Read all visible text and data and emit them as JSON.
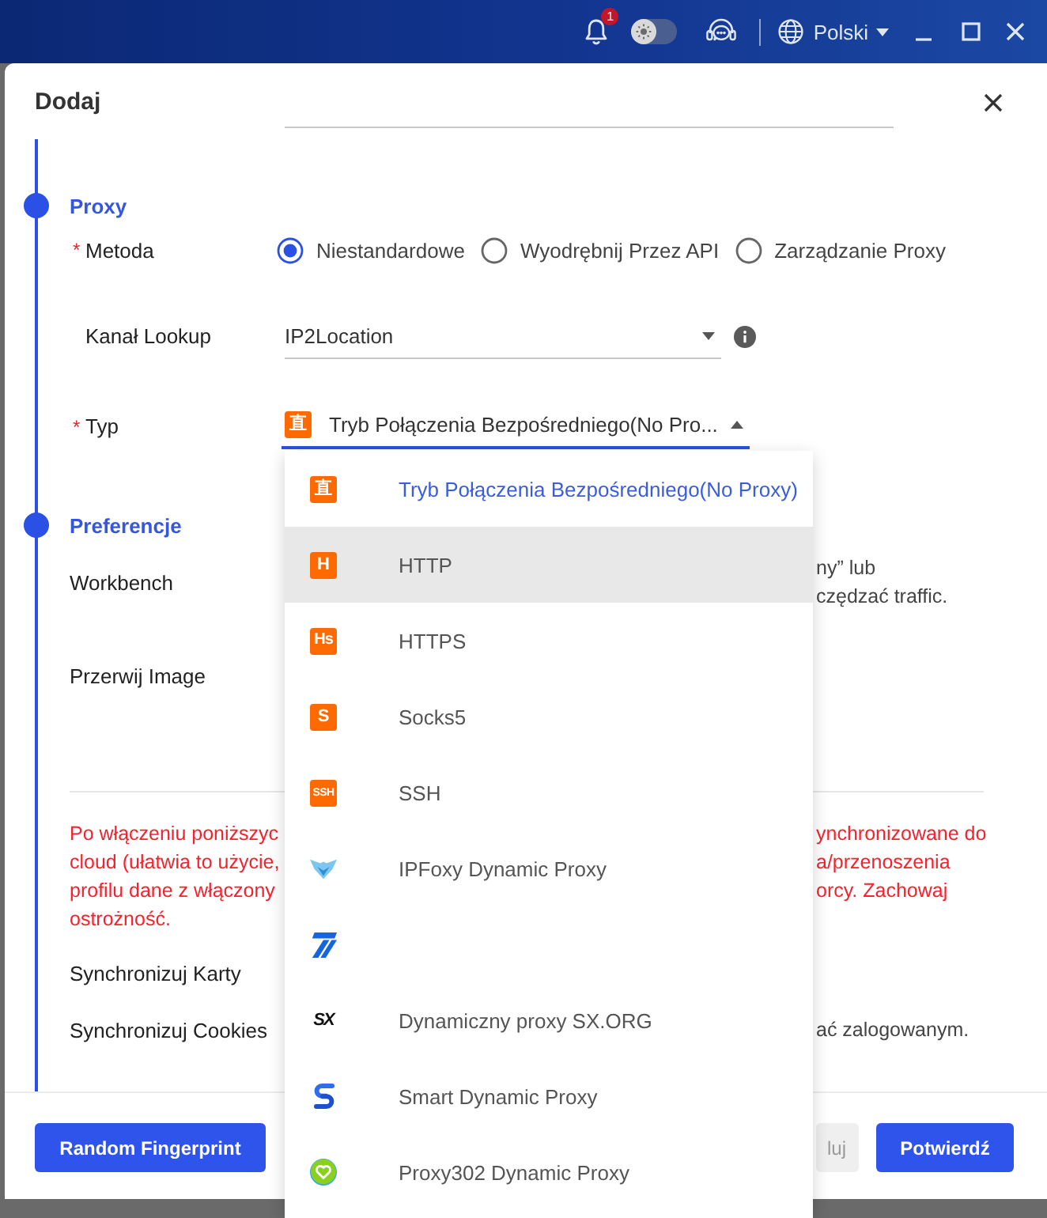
{
  "title_bar": {
    "notification_count": "1",
    "theme_toggle": {
      "on": false
    },
    "language": "Polski"
  },
  "dialog": {
    "title": "Dodaj",
    "sections": [
      {
        "title": "Proxy",
        "fields": [
          {
            "kind": "radio",
            "required_mark": "*",
            "label": "Metoda",
            "options": [
              {
                "label": "Niestandardowe",
                "selected": true
              },
              {
                "label": "Wyodrębnij Przez API",
                "selected": false
              },
              {
                "label": "Zarządzanie Proxy",
                "selected": false
              }
            ]
          },
          {
            "kind": "select",
            "label": "Kanał Lookup",
            "value": "IP2Location",
            "info": true,
            "expanded": false
          },
          {
            "kind": "select",
            "required_mark": "*",
            "label": "Typ",
            "badge": "直",
            "value": "Tryb Połączenia Bezpośredniego(No Pro...",
            "expanded": true
          }
        ]
      },
      {
        "title": "Preferencje",
        "fields": [
          {
            "kind": "setting",
            "label": "Workbench",
            "note_lines": [
              "ny” lub",
              "czędzać traffic."
            ]
          },
          {
            "kind": "setting",
            "label": "Przerwij Image"
          },
          {
            "kind": "warning",
            "left_lines": [
              "Po włączeniu poniższyc",
              "cloud (ułatwia to użycie,",
              "profilu dane z włączony",
              "ostrożność."
            ],
            "right_lines": [
              "ynchronizowane do",
              "a/przenoszenia",
              "orcy. Zachowaj"
            ]
          },
          {
            "kind": "setting",
            "label": "Synchronizuj Karty"
          },
          {
            "kind": "setting",
            "label": "Synchronizuj Cookies",
            "note_lines": [
              "ać zalogowanym."
            ]
          }
        ]
      }
    ]
  },
  "dropdown": {
    "options": [
      {
        "kind": "badge",
        "badge": "直",
        "label": "Tryb Połączenia Bezpośredniego(No Proxy)",
        "selected": true,
        "highlighted": false
      },
      {
        "kind": "badge",
        "badge": "H",
        "label": "HTTP",
        "selected": false,
        "highlighted": true
      },
      {
        "kind": "badge",
        "badge": "Hs",
        "label": "HTTPS",
        "selected": false,
        "highlighted": false
      },
      {
        "kind": "badge",
        "badge": "S",
        "label": "Socks5",
        "selected": false,
        "highlighted": false
      },
      {
        "kind": "badge",
        "badge": "SSH",
        "label": "SSH",
        "selected": false,
        "highlighted": false
      },
      {
        "kind": "wing-logo",
        "label": "IPFoxy Dynamic Proxy",
        "selected": false,
        "highlighted": false
      },
      {
        "kind": "stripe-logo",
        "selected": false,
        "highlighted": false
      },
      {
        "kind": "text-logo",
        "logo_text": "SX",
        "label": "Dynamiczny proxy SX.ORG",
        "selected": false,
        "highlighted": false
      },
      {
        "kind": "hook-logo",
        "label": "Smart Dynamic Proxy",
        "selected": false,
        "highlighted": false
      },
      {
        "kind": "circle-logo",
        "label": "Proxy302 Dynamic Proxy",
        "selected": false,
        "highlighted": false
      }
    ]
  },
  "footer": {
    "buttons": [
      {
        "kind": "primary",
        "label": "Random Fingerprint"
      },
      {
        "kind": "secondary",
        "label": "luj"
      },
      {
        "kind": "primary",
        "label": "Potwierdź"
      }
    ]
  }
}
